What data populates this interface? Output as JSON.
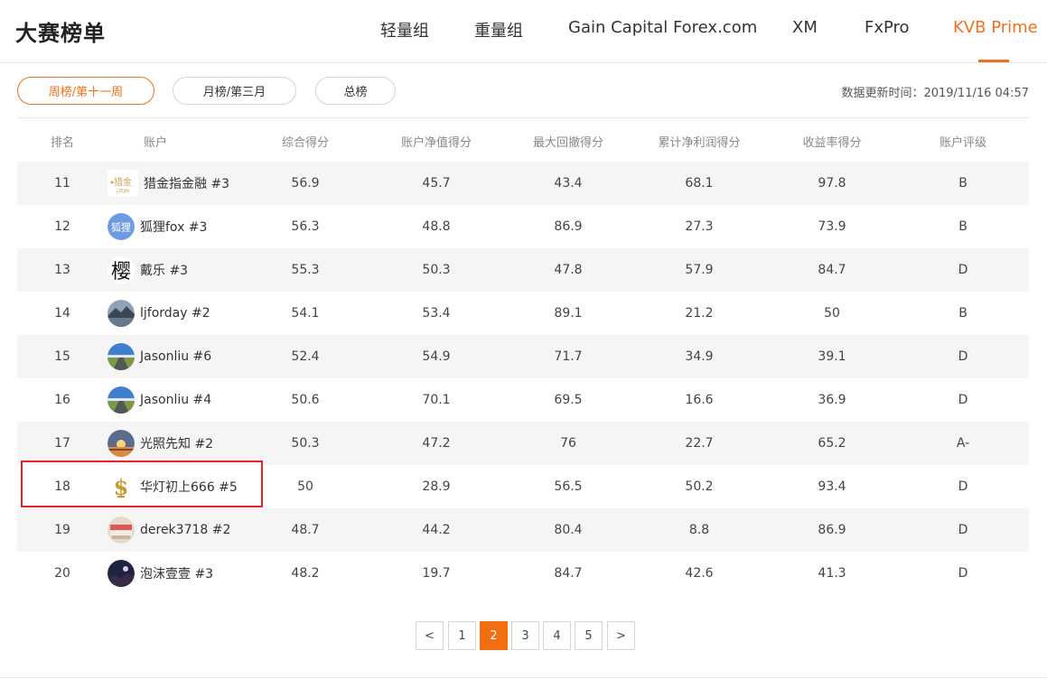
{
  "header": {
    "title": "大赛榜单",
    "nav": [
      {
        "label": "轻量组",
        "active": false
      },
      {
        "label": "重量组",
        "active": false
      },
      {
        "label": "Gain Capital Forex.com",
        "active": false
      },
      {
        "label": "XM",
        "active": false
      },
      {
        "label": "FxPro",
        "active": false
      },
      {
        "label": "KVB Prime",
        "active": true
      }
    ],
    "accent_color": "#f07020"
  },
  "filters": {
    "tabs": [
      {
        "label": "周榜/第十一周",
        "active": true
      },
      {
        "label": "月榜/第三月",
        "active": false
      },
      {
        "label": "总榜",
        "active": false
      }
    ],
    "update_time": "数据更新时间：2019/11/16 04:57"
  },
  "table": {
    "headers": [
      "排名",
      "账户",
      "综合得分",
      "账户净值得分",
      "最大回撤得分",
      "累计净利润得分",
      "收益率得分",
      "账户评级"
    ],
    "rows": [
      {
        "rank": "11",
        "account": "猎金指金融 #3",
        "avatar": "gold-logo",
        "total": "56.9",
        "equity": "45.7",
        "drawdown": "43.4",
        "profit": "68.1",
        "return": "97.8",
        "rating": "B"
      },
      {
        "rank": "12",
        "account": "狐狸fox #3",
        "avatar": "fox-text",
        "total": "56.3",
        "equity": "48.8",
        "drawdown": "86.9",
        "profit": "27.3",
        "return": "73.9",
        "rating": "B"
      },
      {
        "rank": "13",
        "account": "戴乐 #3",
        "avatar": "calligraphy",
        "total": "55.3",
        "equity": "50.3",
        "drawdown": "47.8",
        "profit": "57.9",
        "return": "84.7",
        "rating": "D"
      },
      {
        "rank": "14",
        "account": "ljforday #2",
        "avatar": "mountain",
        "total": "54.1",
        "equity": "53.4",
        "drawdown": "89.1",
        "profit": "21.2",
        "return": "50",
        "rating": "B"
      },
      {
        "rank": "15",
        "account": "Jasonliu #6",
        "avatar": "road",
        "total": "52.4",
        "equity": "54.9",
        "drawdown": "71.7",
        "profit": "34.9",
        "return": "39.1",
        "rating": "D"
      },
      {
        "rank": "16",
        "account": "Jasonliu #4",
        "avatar": "road",
        "total": "50.6",
        "equity": "70.1",
        "drawdown": "69.5",
        "profit": "16.6",
        "return": "36.9",
        "rating": "D"
      },
      {
        "rank": "17",
        "account": "光照先知 #2",
        "avatar": "sunset",
        "total": "50.3",
        "equity": "47.2",
        "drawdown": "76",
        "profit": "22.7",
        "return": "65.2",
        "rating": "A-"
      },
      {
        "rank": "18",
        "account": "华灯初上666 #5",
        "avatar": "dollar",
        "total": "50",
        "equity": "28.9",
        "drawdown": "56.5",
        "profit": "50.2",
        "return": "93.4",
        "rating": "D"
      },
      {
        "rank": "19",
        "account": "derek3718 #2",
        "avatar": "banknotes",
        "total": "48.7",
        "equity": "44.2",
        "drawdown": "80.4",
        "profit": "8.8",
        "return": "86.9",
        "rating": "D"
      },
      {
        "rank": "20",
        "account": "泡沫壹壹 #3",
        "avatar": "night",
        "total": "48.2",
        "equity": "19.7",
        "drawdown": "84.7",
        "profit": "42.6",
        "return": "41.3",
        "rating": "D"
      }
    ],
    "highlighted_rank": "18",
    "highlight_color": "#e8202a"
  },
  "pagination": {
    "prev": "<",
    "next": ">",
    "pages": [
      "1",
      "2",
      "3",
      "4",
      "5"
    ],
    "current": "2"
  }
}
